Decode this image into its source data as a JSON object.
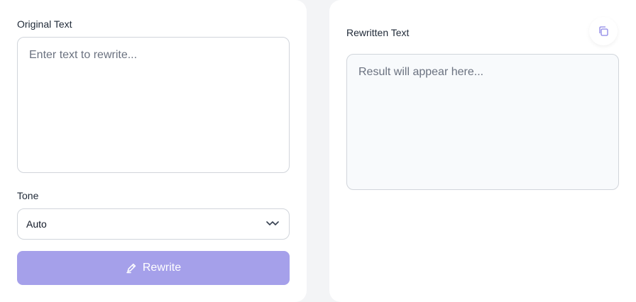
{
  "left": {
    "original_label": "Original Text",
    "original_placeholder": "Enter text to rewrite...",
    "tone_label": "Tone",
    "tone_value": "Auto",
    "rewrite_label": "Rewrite"
  },
  "right": {
    "rewritten_label": "Rewritten Text",
    "result_placeholder": "Result will appear here..."
  },
  "icons": {
    "copy": "copy-icon",
    "chevron": "chevron-down-icon",
    "rewrite": "pen-icon"
  },
  "colors": {
    "accent": "#a5a0ea",
    "icon": "#8b85e6"
  }
}
